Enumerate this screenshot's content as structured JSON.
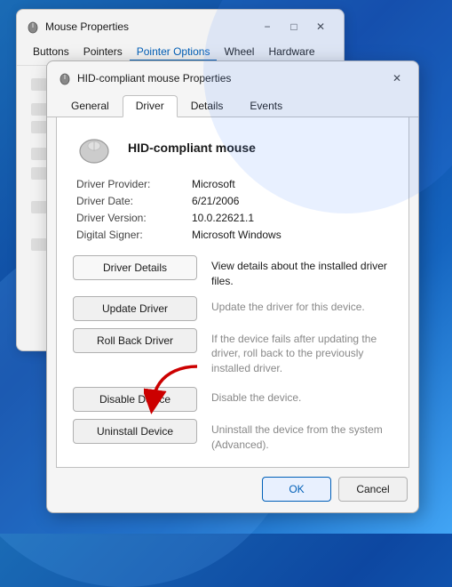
{
  "bgWindow": {
    "title": "Mouse Properties",
    "icon": "🖱",
    "tabs": [
      "Buttons",
      "Pointers",
      "Pointer Options",
      "Wheel",
      "Hardware"
    ],
    "activeTab": "Pointer Options",
    "controls": {
      "minimize": "−",
      "maximize": "□",
      "close": "✕"
    }
  },
  "mainDialog": {
    "title": "HID-compliant mouse Properties",
    "icon": "🖱",
    "tabs": [
      "General",
      "Driver",
      "Details",
      "Events"
    ],
    "activeTab": "Driver",
    "deviceName": "HID-compliant mouse",
    "driverInfo": {
      "provider_label": "Driver Provider:",
      "provider_value": "Microsoft",
      "date_label": "Driver Date:",
      "date_value": "6/21/2006",
      "version_label": "Driver Version:",
      "version_value": "10.0.22621.1",
      "signer_label": "Digital Signer:",
      "signer_value": "Microsoft Windows"
    },
    "actions": [
      {
        "button": "Driver Details",
        "desc": "View details about the installed driver files.",
        "disabled": false
      },
      {
        "button": "Update Driver",
        "desc": "Update the driver for this device.",
        "disabled": true
      },
      {
        "button": "Roll Back Driver",
        "desc": "If the device fails after updating the driver, roll back to the previously installed driver.",
        "disabled": true
      },
      {
        "button": "Disable Device",
        "desc": "Disable the device.",
        "disabled": true,
        "hasArrow": true
      },
      {
        "button": "Uninstall Device",
        "desc": "Uninstall the device from the system (Advanced).",
        "disabled": true
      }
    ],
    "footer": {
      "ok": "OK",
      "cancel": "Cancel"
    },
    "controls": {
      "close": "✕"
    }
  }
}
